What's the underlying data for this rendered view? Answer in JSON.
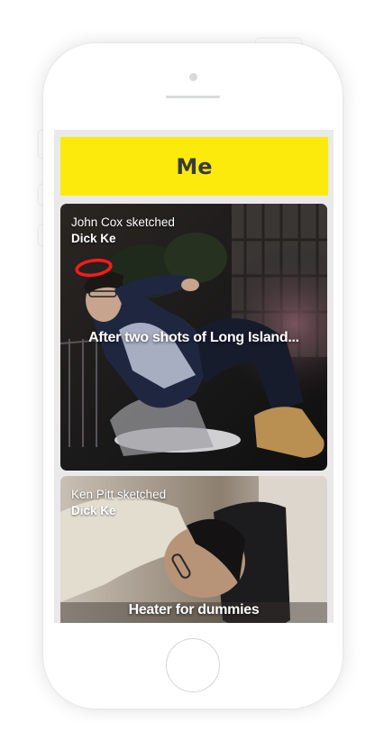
{
  "header": {
    "title": "Me",
    "background": "#fcea0d"
  },
  "feed": [
    {
      "author": "John Cox",
      "verb": "sketched",
      "subject": "Dick Ke",
      "caption": "After two shots of Long Island...",
      "sketch_color": "#ff1a1a"
    },
    {
      "author": "Ken Pitt",
      "verb": "sketched",
      "subject": "Dick Ke",
      "caption": "Heater for dummies"
    }
  ]
}
